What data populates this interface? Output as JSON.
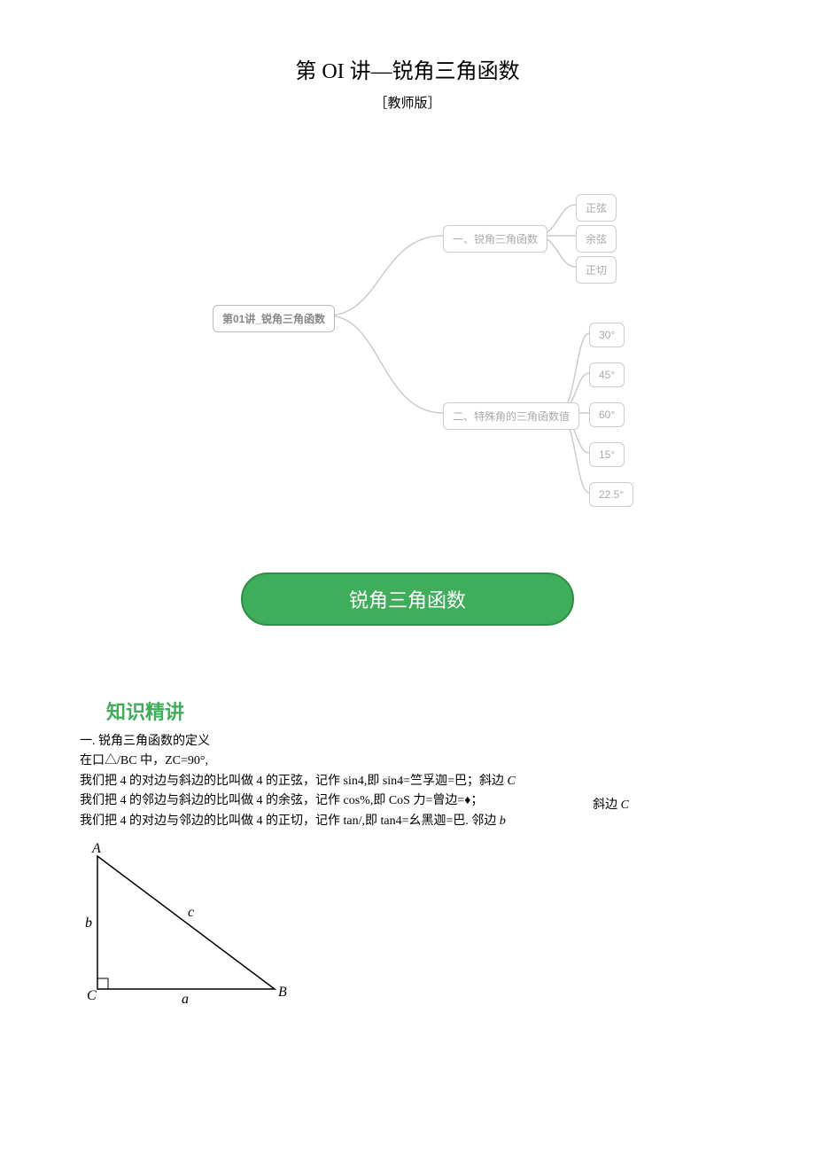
{
  "title": "第 OI 讲—锐角三角函数",
  "subtitle": "［教师版］",
  "mindmap": {
    "root": "第01讲_锐角三角函数",
    "b1": "一、锐角三角函数",
    "b1_1": "正弦",
    "b1_2": "余弦",
    "b1_3": "正切",
    "b2": "二、特殊角的三角函数值",
    "b2_1": "30°",
    "b2_2": "45°",
    "b2_3": "60°",
    "b2_4": "15°",
    "b2_5": "22.5°"
  },
  "pill": "锐角三角函数",
  "sectionHeader": "知识精讲",
  "def_h": "一. 锐角三角函数的定义",
  "def_l1_a": "在口△/BC 中，ZC=90°,",
  "def_l2": "我们把 4 的对边与斜边的比叫做 4 的正弦，记作 sin4,即 sin4=竺孚迦=巴；斜边 ",
  "def_l2_c": "C",
  "def_l3": "我们把 4 的邻边与斜边的比叫做 4 的余弦，记作 cos%,即 CoS 力=曾边=♦；",
  "def_l3_side": "斜边 ",
  "def_l3_side_c": "C",
  "def_l4": "我们把 4 的对边与邻边的比叫做 4 的正切，记作 tan/,即 tan4=幺黑迦=巴. 邻边 ",
  "def_l4_b": "b",
  "tri": {
    "A": "A",
    "B": "B",
    "C": "C",
    "a": "a",
    "b": "b",
    "c": "c"
  }
}
